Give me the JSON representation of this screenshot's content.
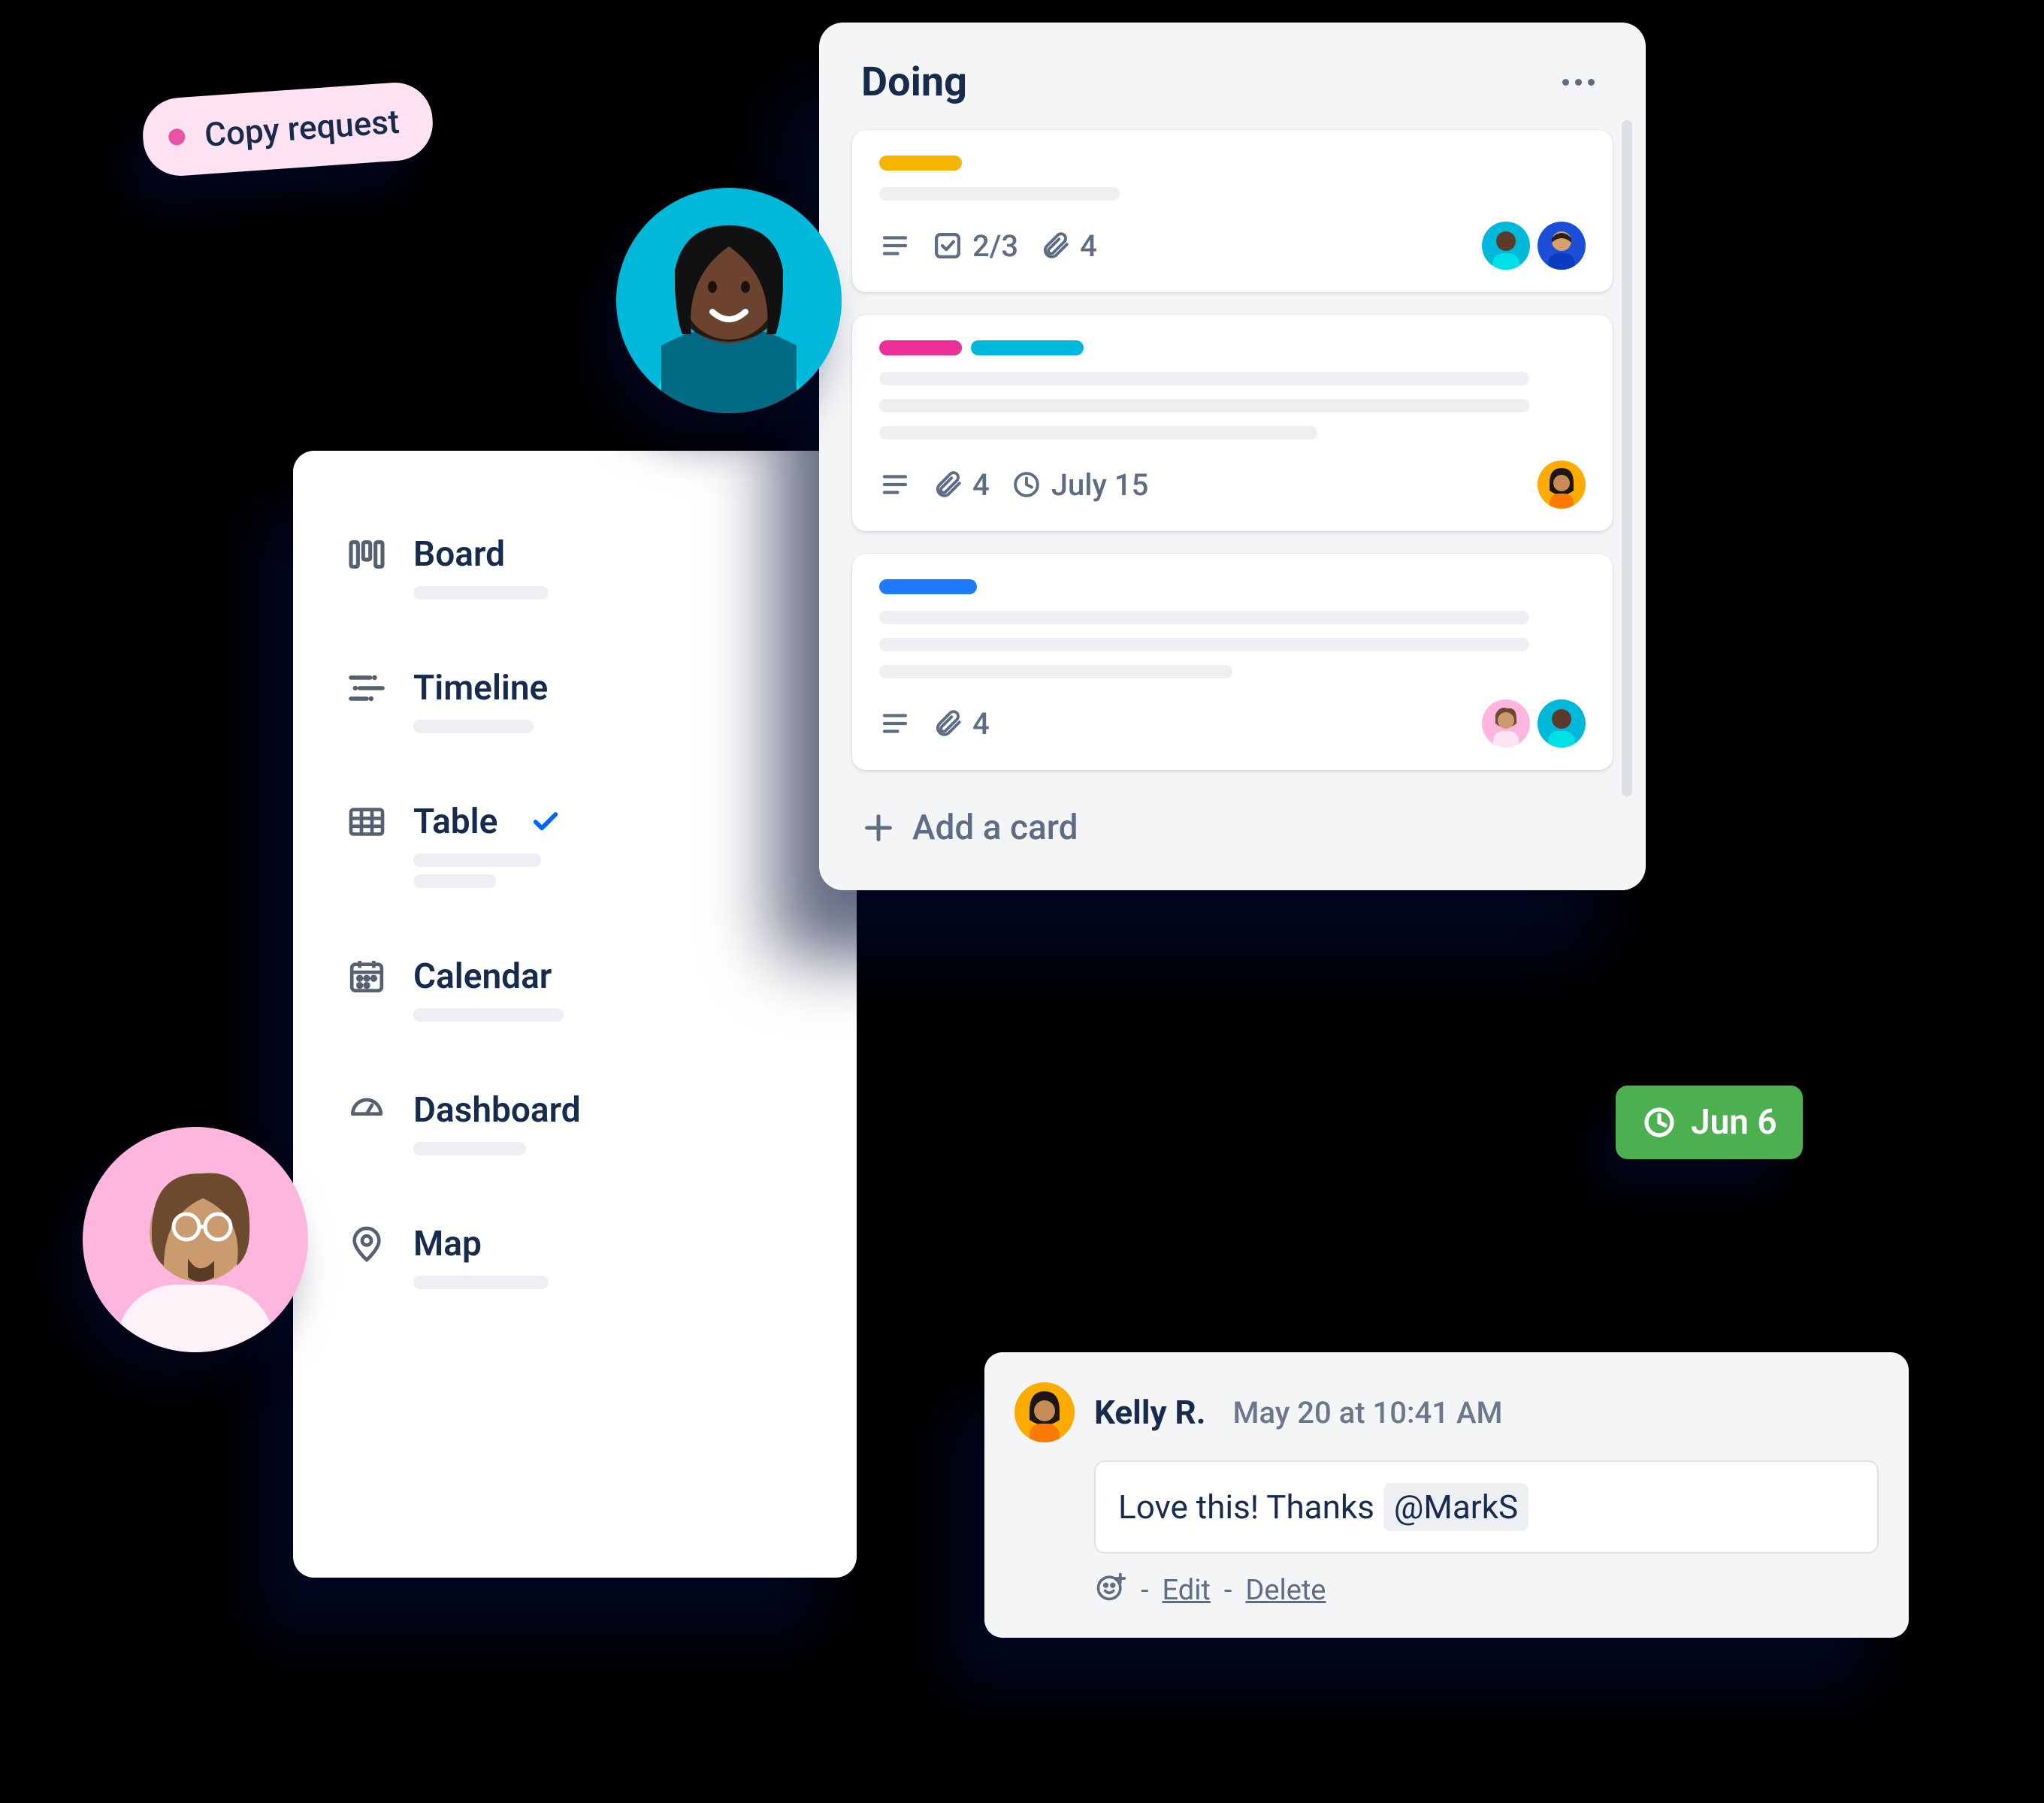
{
  "chip": {
    "label": "Copy request"
  },
  "views": {
    "items": [
      {
        "label": "Board",
        "icon": "board",
        "selected": false
      },
      {
        "label": "Timeline",
        "icon": "timeline",
        "selected": false
      },
      {
        "label": "Table",
        "icon": "table",
        "selected": true
      },
      {
        "label": "Calendar",
        "icon": "calendar",
        "selected": false
      },
      {
        "label": "Dashboard",
        "icon": "dashboard",
        "selected": false
      },
      {
        "label": "Map",
        "icon": "map",
        "selected": false
      }
    ]
  },
  "column": {
    "title": "Doing",
    "add_card_label": "Add a card",
    "cards": [
      {
        "labels": [
          {
            "color": "#F5B400",
            "w": 110
          }
        ],
        "checklist": "2/3",
        "attachments": "4",
        "members": [
          "teal-woman",
          "blue-man"
        ]
      },
      {
        "labels": [
          {
            "color": "#EB2F96",
            "w": 110
          },
          {
            "color": "#00B8D9",
            "w": 150
          }
        ],
        "attachments": "4",
        "due": "July 15",
        "members": [
          "yellow-woman"
        ]
      },
      {
        "labels": [
          {
            "color": "#1D7AFC",
            "w": 130
          }
        ],
        "attachments": "4",
        "members": [
          "pink-man",
          "teal-woman"
        ]
      }
    ]
  },
  "due_badge": {
    "label": "Jun 6"
  },
  "comment": {
    "author": "Kelly R.",
    "timestamp": "May 20 at 10:41 AM",
    "text": "Love this! Thanks",
    "mention": "@MarkS",
    "actions": {
      "edit": "Edit",
      "delete": "Delete",
      "sep": "-"
    }
  },
  "colors": {
    "text": "#172B4D",
    "muted": "#5E6C84",
    "panel": "#F4F5F7",
    "green": "#4CAF50",
    "pinkchip": "#FDE2F1"
  }
}
